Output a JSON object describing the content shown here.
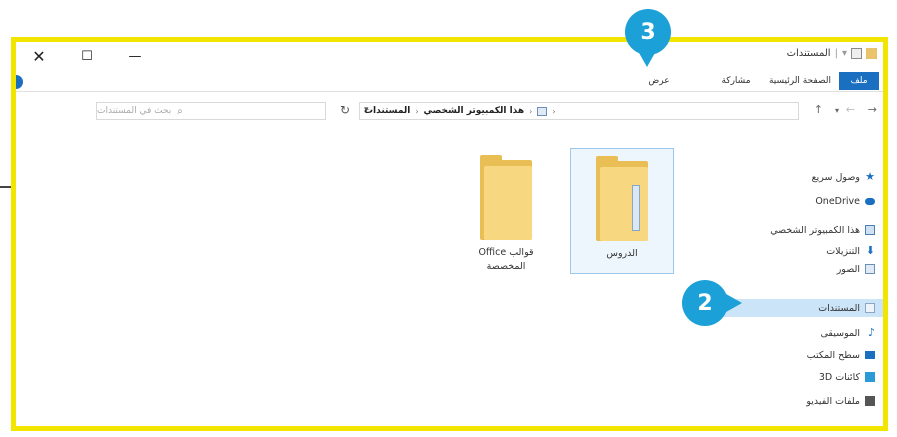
{
  "window": {
    "title": "المستندات",
    "close_glyph": "✕",
    "maximize_glyph": "☐",
    "minimize_glyph": "—"
  },
  "ribbon": {
    "tabs": [
      "ملف",
      "الصفحة الرئيسية",
      "مشاركة",
      "عرض"
    ]
  },
  "address": {
    "path": [
      "هذا الكمبيوتر الشخصي",
      "المستندات"
    ],
    "search_placeholder": "بحث في المستندات"
  },
  "nav_pane": {
    "items": [
      {
        "label": "وصول سريع",
        "icon": "star-icon",
        "color": "#1a6fc1"
      },
      {
        "label": "OneDrive",
        "icon": "cloud-icon",
        "color": "#1a6fc1"
      },
      {
        "label": "هذا الكمبيوتر الشخصي",
        "icon": "computer-icon",
        "color": "#4d7fb8"
      },
      {
        "label": "التنزيلات",
        "icon": "download-icon",
        "color": "#1a6fc1"
      },
      {
        "label": "الصور",
        "icon": "pictures-icon",
        "color": "#6b8fb5"
      },
      {
        "label": "المستندات",
        "icon": "documents-icon",
        "color": "#8aa7c6"
      },
      {
        "label": "الموسيقى",
        "icon": "music-icon",
        "color": "#1a6fc1"
      },
      {
        "label": "سطح المكتب",
        "icon": "desktop-icon",
        "color": "#1a6fc1"
      },
      {
        "label": "كائنات 3D",
        "icon": "3d-objects-icon",
        "color": "#2b9bd8"
      },
      {
        "label": "ملفات الفيديو",
        "icon": "videos-icon",
        "color": "#555555"
      }
    ],
    "selected_index": 5
  },
  "content": {
    "folders": [
      {
        "label": "الدروس",
        "selected": true
      },
      {
        "label": "قوالب Office المخصصة"
      }
    ]
  },
  "callouts": [
    "3",
    "2"
  ],
  "colors": {
    "frame": "#f2e500",
    "callout": "#1ba0d7",
    "file_tab": "#1a6fc1",
    "folder": "#e9be55"
  }
}
